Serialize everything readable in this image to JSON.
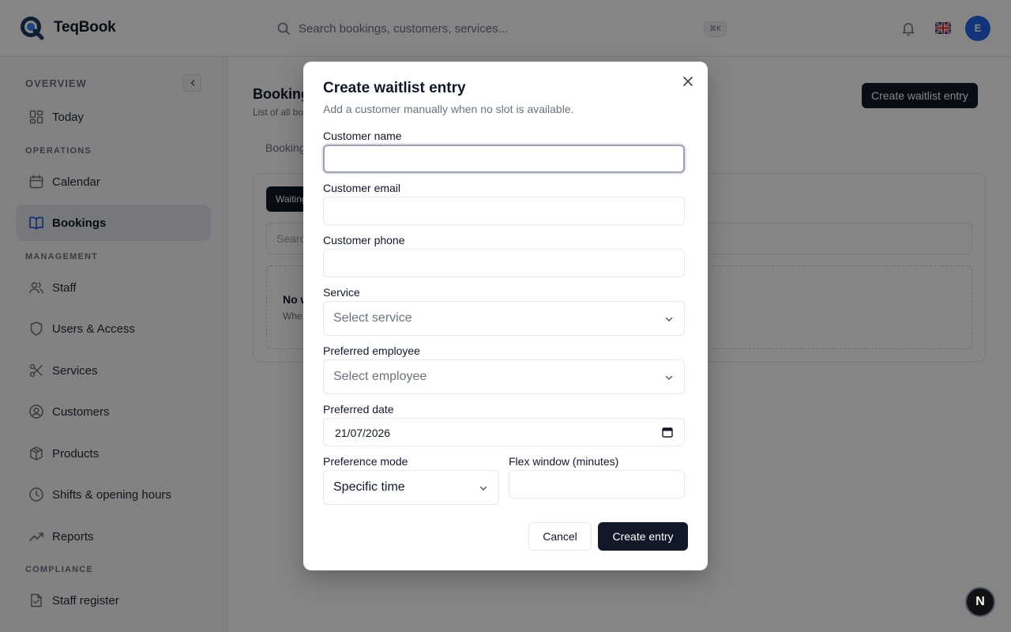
{
  "app": {
    "name": "TeqBook"
  },
  "topbar": {
    "search_placeholder": "Search bookings, customers, services...",
    "shortcut": "⌘K",
    "avatar_initial": "E"
  },
  "sidebar": {
    "sections": {
      "overview": "OVERVIEW",
      "operations": "OPERATIONS",
      "management": "MANAGEMENT",
      "compliance": "COMPLIANCE"
    },
    "items": {
      "today": "Today",
      "calendar": "Calendar",
      "bookings": "Bookings",
      "staff": "Staff",
      "users_access": "Users & Access",
      "services": "Services",
      "customers": "Customers",
      "products": "Products",
      "shifts": "Shifts & opening hours",
      "reports": "Reports",
      "staff_register": "Staff register"
    },
    "active": "bookings"
  },
  "main": {
    "title": "Bookings",
    "subtitle": "List of all bo",
    "create_button": "Create waitlist entry",
    "tab_label": "Booking",
    "pill_label": "Waiting",
    "search_placeholder": "Search",
    "empty_title": "No w",
    "empty_sub": "Whe"
  },
  "modal": {
    "title": "Create waitlist entry",
    "subtitle": "Add a customer manually when no slot is available.",
    "fields": {
      "customer_name": {
        "label": "Customer name",
        "value": ""
      },
      "customer_email": {
        "label": "Customer email",
        "value": ""
      },
      "customer_phone": {
        "label": "Customer phone",
        "value": ""
      },
      "service": {
        "label": "Service",
        "placeholder": "Select service"
      },
      "employee": {
        "label": "Preferred employee",
        "placeholder": "Select employee"
      },
      "date": {
        "label": "Preferred date",
        "value": "21/07/2026"
      },
      "mode": {
        "label": "Preference mode",
        "value": "Specific time"
      },
      "flex": {
        "label": "Flex window (minutes)",
        "value": ""
      }
    },
    "cancel_label": "Cancel",
    "submit_label": "Create entry"
  },
  "badge": {
    "label": "N"
  },
  "colors": {
    "primary": "#111827",
    "avatar": "#2563eb",
    "overlay": "rgba(0,0,0,0.48)"
  }
}
